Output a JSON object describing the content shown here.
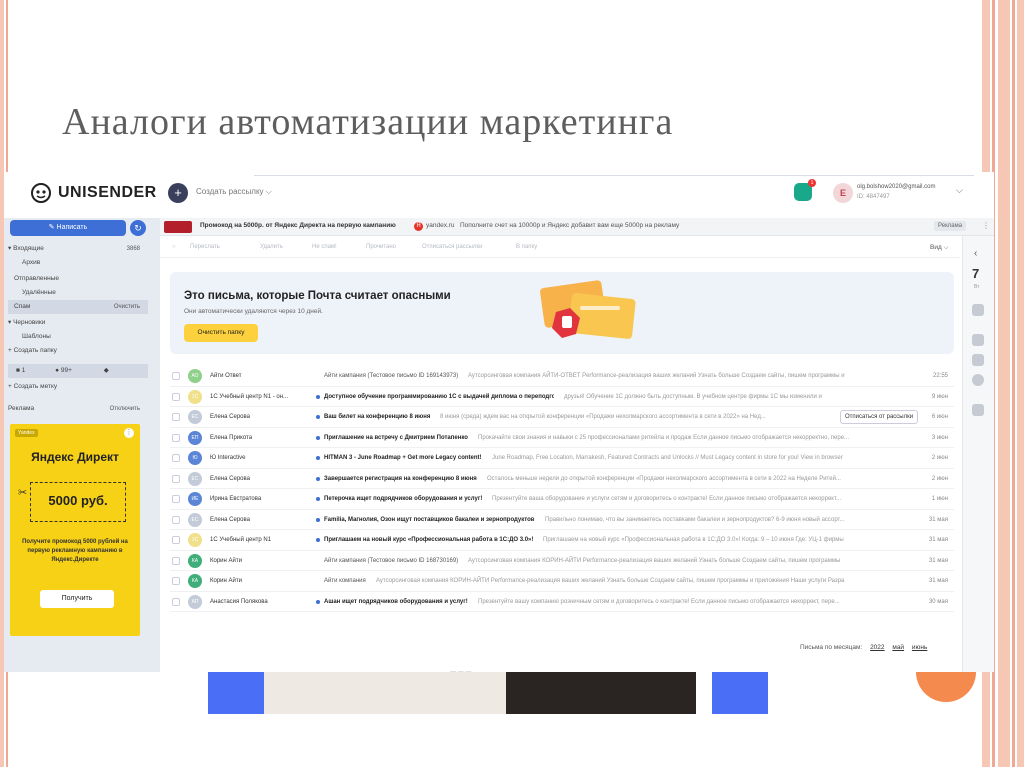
{
  "slide": {
    "title": "Аналоги автоматизации маркетинга"
  },
  "colors": {
    "stripe_peach": "#f7c7b6",
    "stripe_line": "#efa894",
    "orange_circle": "#f48a4e",
    "blue_block": "#4a6ef5",
    "accent": "#3d6fd7"
  },
  "app": {
    "logo": "UNISENDER",
    "compose_dropdown": "Создать рассылку",
    "user_email": "olg.bolshow2020@gmail.com",
    "user_id": "ID: 4847497",
    "avatar_letter": "E",
    "notif_count": "1"
  },
  "sidebar": {
    "write_button": "Написать",
    "folders": [
      {
        "label": "▾ Входящие",
        "count": "3868"
      },
      {
        "label": "Архив",
        "count": ""
      },
      {
        "label": "Отправленные",
        "count": ""
      },
      {
        "label": "Удалённые",
        "count": ""
      },
      {
        "label": "Спам",
        "count": "Очистить"
      },
      {
        "label": "▾ Черновики",
        "count": ""
      },
      {
        "label": "Шаблоны",
        "count": ""
      },
      {
        "label": "+ Создать папку",
        "count": ""
      }
    ],
    "tags_row": [
      "■ 1",
      "● 99+",
      "◆"
    ],
    "create_label": "+ Создать метку",
    "ads_label": "Реклама",
    "ads_off": "Отключить",
    "ad": {
      "badge": "Yandex",
      "title": "Яндекс Директ",
      "coupon": "5000 руб.",
      "text": "Получите промокод 5000 рублей на первую рекламную кампанию в Яндекс.Директе",
      "button": "Получить"
    }
  },
  "promo": {
    "text": "Промокод на 5000р. от Яндекс Директа на первую кампанию",
    "source": "yandex.ru",
    "desc": "Пополните счет на 10000р и Яндекс добавит вам еще 5000р на рекламу",
    "label": "Реклама"
  },
  "toolbar": {
    "items": [
      "Переслать",
      "Удалить",
      "Не спам!",
      "Прочитано",
      "Отписаться рассылки",
      "В папку"
    ],
    "view": "Вид ⌵"
  },
  "spam_banner": {
    "title": "Это письма, которые Почта считает опасными",
    "subtitle": "Они автоматически удаляются через 10 дней.",
    "button": "Очистить папку"
  },
  "emails": [
    {
      "initials": "АО",
      "color": "#8fd08a",
      "sender": "Айти Ответ",
      "subject": "Айти кампания (Тестовое письмо ID 169143973)",
      "snippet": "Аутсорсинговая компания АЙТИ-ОТВЕТ Performance-реализация ваших желаний Узнать больше Создаем сайты, пишем программы и",
      "date": "22:55",
      "read": true,
      "dot": false
    },
    {
      "initials": "1С",
      "color": "#f0e08c",
      "sender": "1С Учебный центр N1 - он...",
      "subject": "Доступное обучение программированию 1С с выдачей диплома о переподготовке!",
      "snippet": "друзья! Обучение 1С должно быть доступным. В учебном центре фирмы 1С мы изменили и",
      "date": "9 июн",
      "read": false,
      "dot": true
    },
    {
      "initials": "ЕС",
      "color": "#c3cad8",
      "sender": "Елена Серова",
      "subject": "Ваш билет на конференцию 8 июня",
      "snippet": "8 июня (среда) ждем вас на открытой конференции «Продажи нехолмарского ассортимента в сети в 2022» на Нед...",
      "date": "6 июн",
      "read": false,
      "dot": true,
      "unsub": "Отписаться от рассылки"
    },
    {
      "initials": "ЕП",
      "color": "#5b85d6",
      "sender": "Елена Прикота",
      "subject": "Приглашение на встречу с Дмитрием Потапенко",
      "snippet": "Прокачайте свои знания и навыки с 25 профессионалами ритейла и продаж Если данное письмо отображается некорректно, пере...",
      "date": "3 июн",
      "read": false,
      "dot": true
    },
    {
      "initials": "Ю",
      "color": "#5b85d6",
      "sender": "Ю Interactive",
      "subject": "HITMAN 3 - June Roadmap + Get more Legacy content!",
      "snippet": "June Roadmap, Free Location, Marrakesh, Featured Contracts and Unlocks // Must Legacy content in store for you! View in browser",
      "date": "2 июн",
      "read": false,
      "dot": true
    },
    {
      "initials": "ЕС",
      "color": "#c3cad8",
      "sender": "Елена Серова",
      "subject": "Завершается регистрация на конференцию 8 июня",
      "snippet": "Осталось меньше недели до открытой конференции «Продажи нехолмарского ассортимента в сети в 2022 на Неделе Ритей...",
      "date": "2 июн",
      "read": false,
      "dot": true
    },
    {
      "initials": "ИЕ",
      "color": "#5b85d6",
      "sender": "Ирина Евстратова",
      "subject": "Петерочка ищет подрядчиков оборудования и услуг!",
      "snippet": "Презентуйте ваша оборудование и услуги сетям и договоритесь о контракте! Если данное письмо отображается некоррект...",
      "date": "1 июн",
      "read": false,
      "dot": true
    },
    {
      "initials": "ЕС",
      "color": "#c3cad8",
      "sender": "Елена Серова",
      "subject": "Familia, Магнолия, Озон ищут поставщиков бакалеи и зернопродуктов",
      "snippet": "Правильно понимаю, что вы занимаетесь поставками бакалеи и зернопродуктов? 6-9 июня новый ассорт...",
      "date": "31 мая",
      "read": false,
      "dot": true
    },
    {
      "initials": "1С",
      "color": "#f0e08c",
      "sender": "1С Учебный центр N1",
      "subject": "Приглашаем на новый курс «Профессиональная работа в 1С:ДО 3.0»!",
      "snippet": "Приглашаем на новый курс «Профессиональная работа в 1С:ДО 3.0»! Когда: 9 – 10 июня Где: УЦ-1 фирмы",
      "date": "31 мая",
      "read": false,
      "dot": true
    },
    {
      "initials": "КА",
      "color": "#3fae7a",
      "sender": "Корин Айти",
      "subject": "Айти кампания (Тестовое письмо ID 168730169)",
      "snippet": "Аутсорсинговая компания КОРИН-АЙТИ Performance-реализация ваших желаний Узнать больше Создаем сайты, пишем программы",
      "date": "31 мая",
      "read": true,
      "dot": false
    },
    {
      "initials": "КА",
      "color": "#3fae7a",
      "sender": "Корин Айти",
      "subject": "Айти компания",
      "snippet": "Аутсорсинговая компания КОРИН-АЙТИ Performance-реализация ваших желаний Узнать больше Создаем сайты, пишем программы и приложения Наши услуги Разра",
      "date": "31 мая",
      "read": true,
      "dot": false
    },
    {
      "initials": "АП",
      "color": "#c3cad8",
      "sender": "Анастасия Полякова",
      "subject": "Ашан ищет подрядчиков оборудования и услуг!",
      "snippet": "Презентуйте вашу компанию розничным сетям и договоритесь о контракте! Если данное письмо отображается некоррект, пере...",
      "date": "30 мая",
      "read": false,
      "dot": true
    }
  ],
  "pager": {
    "label": "Письма по месяцам:",
    "year": "2022",
    "may": "май",
    "june": "июнь"
  },
  "rail": {
    "day": "7",
    "dow": "Вт"
  }
}
